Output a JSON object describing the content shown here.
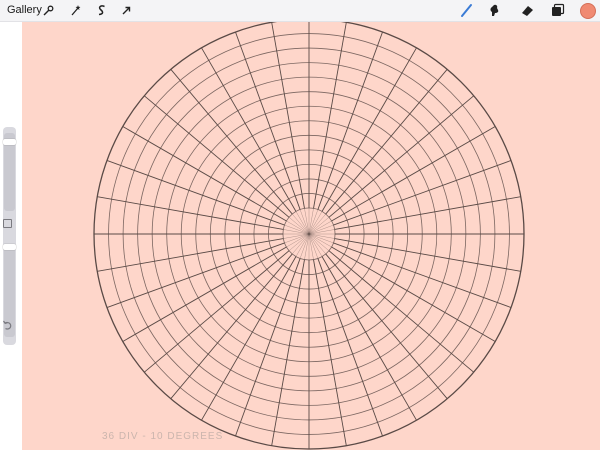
{
  "toolbar": {
    "gallery_label": "Gallery",
    "left_tools": [
      {
        "icon": "wrench-icon",
        "name": "actions-tool"
      },
      {
        "icon": "magic-wand-icon",
        "name": "adjustments-tool"
      },
      {
        "icon": "selection-s-icon",
        "name": "selection-tool"
      },
      {
        "icon": "arrow-cursor-icon",
        "name": "transform-tool"
      }
    ],
    "right_tools": [
      {
        "icon": "brush-icon",
        "name": "brush-tool"
      },
      {
        "icon": "smudge-icon",
        "name": "smudge-tool"
      },
      {
        "icon": "eraser-icon",
        "name": "eraser-tool"
      },
      {
        "icon": "layers-icon",
        "name": "layers-tool"
      }
    ],
    "active_tool": "brush-tool",
    "active_color": "#f08a72"
  },
  "sidebar": {
    "brush_size_level": 0.92,
    "opacity_level": 0.97,
    "modify_icon": "square-icon",
    "undo_icon": "undo-icon"
  },
  "canvas": {
    "background_color": "#fed6ca",
    "line_color": "#5a4a46",
    "radial_divisions": 36,
    "concentric_rings": 13,
    "caption": "36 DIV - 10 DEGREES"
  }
}
